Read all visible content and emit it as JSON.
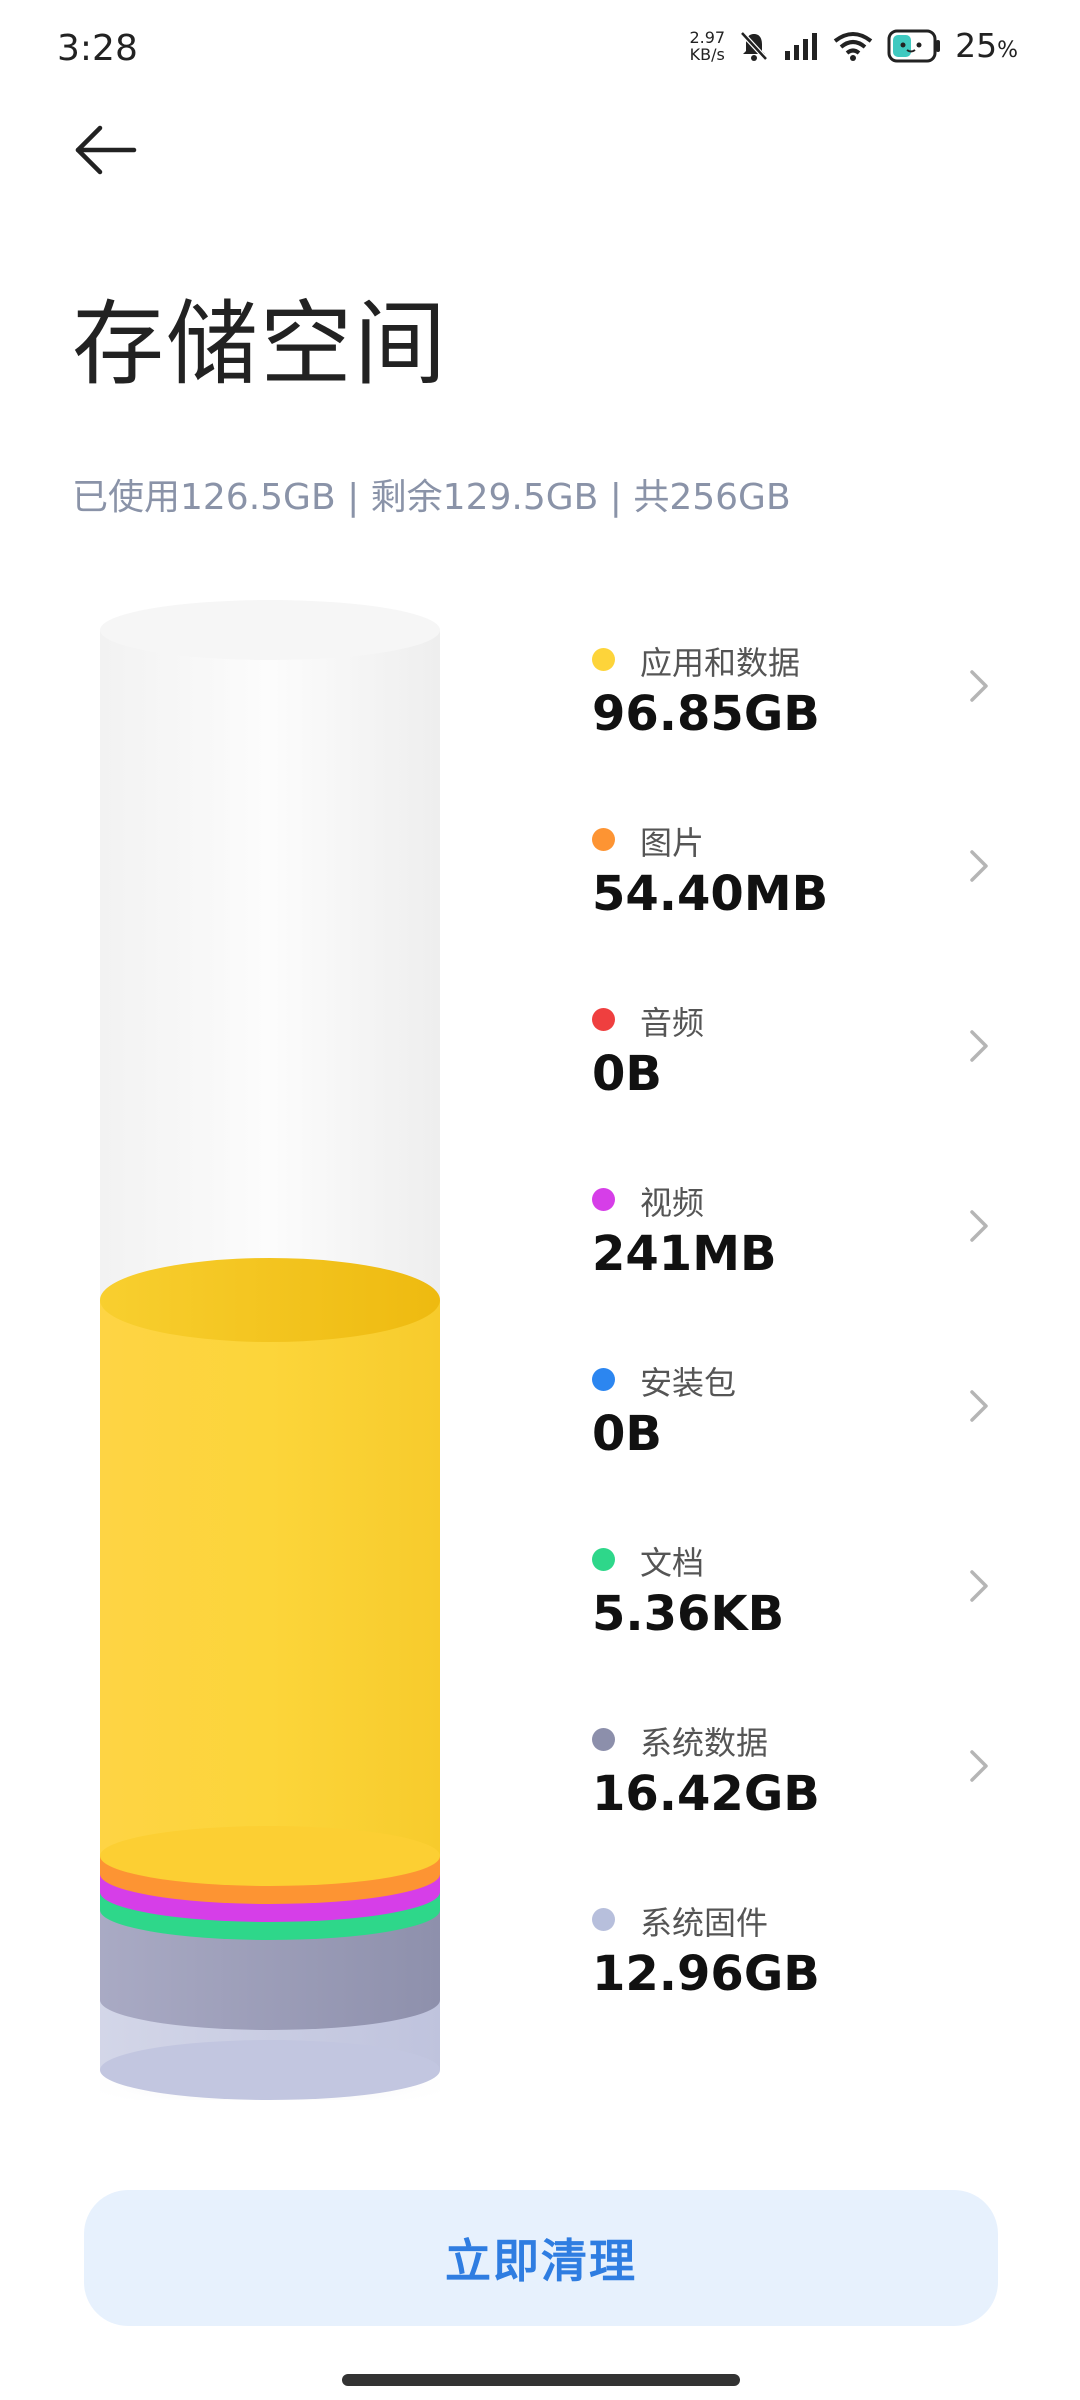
{
  "status": {
    "time": "3:28",
    "net_speed_value": "2.97",
    "net_speed_unit": "KB/s",
    "battery_value": "25",
    "battery_unit": "%",
    "icons": [
      "mute-icon",
      "signal-icon",
      "wifi-icon",
      "battery-icon"
    ]
  },
  "header": {
    "back_icon": "arrow-left-icon",
    "title": "存储空间",
    "summary": "已使用126.5GB | 剩余129.5GB | 共256GB"
  },
  "usage": {
    "used_fraction": 0.494,
    "segments": [
      {
        "name": "应用和数据",
        "size": "96.85GB",
        "color": "#fdd43a",
        "chevron": true
      },
      {
        "name": "图片",
        "size": "54.40MB",
        "color": "#fd9433",
        "chevron": true
      },
      {
        "name": "音频",
        "size": "0B",
        "color": "#ef3f3f",
        "chevron": true
      },
      {
        "name": "视频",
        "size": "241MB",
        "color": "#d63ee8",
        "chevron": true
      },
      {
        "name": "安装包",
        "size": "0B",
        "color": "#2c86f0",
        "chevron": true
      },
      {
        "name": "文档",
        "size": "5.36KB",
        "color": "#2ed78a",
        "chevron": true
      },
      {
        "name": "系统数据",
        "size": "16.42GB",
        "color": "#8c8fab",
        "chevron": true
      },
      {
        "name": "系统固件",
        "size": "12.96GB",
        "color": "#b7bfdc",
        "chevron": false
      }
    ]
  },
  "actions": {
    "clean_label": "立即清理"
  }
}
